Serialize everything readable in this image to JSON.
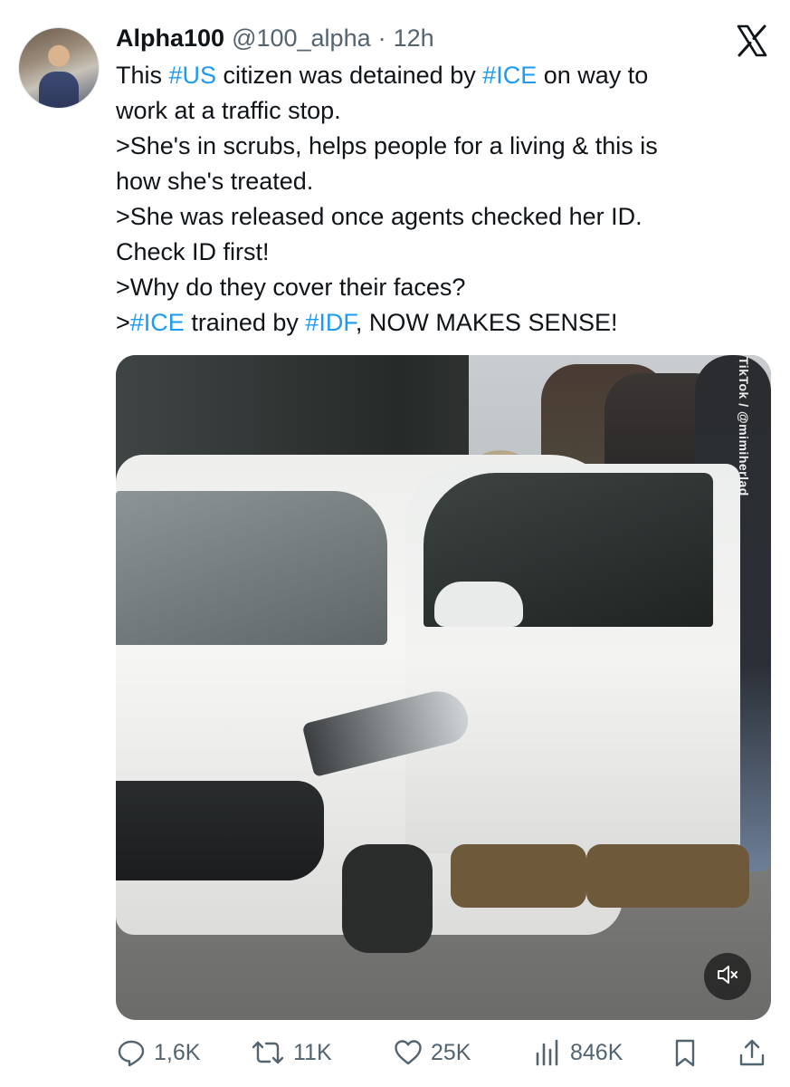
{
  "user": {
    "name": "Alpha100",
    "handle": "@100_alpha",
    "separator": "·",
    "time": "12h",
    "avatar_icon": "profile-avatar"
  },
  "platform_logo": "x-logo",
  "tweet": {
    "lines": [
      [
        {
          "t": "This ",
          "tag": false
        },
        {
          "t": "#US",
          "tag": true
        },
        {
          "t": " citizen was detained by ",
          "tag": false
        },
        {
          "t": "#ICE",
          "tag": true
        },
        {
          "t": " on way to",
          "tag": false
        }
      ],
      [
        {
          "t": "work at a traffic stop.",
          "tag": false
        }
      ],
      [
        {
          "t": ">She's in scrubs, helps people for a living & this is",
          "tag": false
        }
      ],
      [
        {
          "t": "how she's treated.",
          "tag": false
        }
      ],
      [
        {
          "t": ">She was released once agents checked her ID.",
          "tag": false
        }
      ],
      [
        {
          "t": "Check ID first!",
          "tag": false
        }
      ],
      [
        {
          "t": ">Why do they cover their faces?",
          "tag": false
        }
      ],
      [
        {
          "t": ">",
          "tag": false
        },
        {
          "t": "#ICE",
          "tag": true
        },
        {
          "t": " trained by ",
          "tag": false
        },
        {
          "t": "#IDF",
          "tag": true
        },
        {
          "t": ", NOW MAKES SENSE!",
          "tag": false
        }
      ]
    ]
  },
  "media": {
    "watermark": "TikTok / @mimiherlad",
    "mute_icon": "speaker-muted-icon"
  },
  "actions": {
    "replies": "1,6K",
    "reposts": "11K",
    "likes": "25K",
    "views": "846K"
  },
  "colors": {
    "text": "#0f1419",
    "secondary": "#536471",
    "link": "#1d9bf0",
    "background": "#ffffff"
  }
}
